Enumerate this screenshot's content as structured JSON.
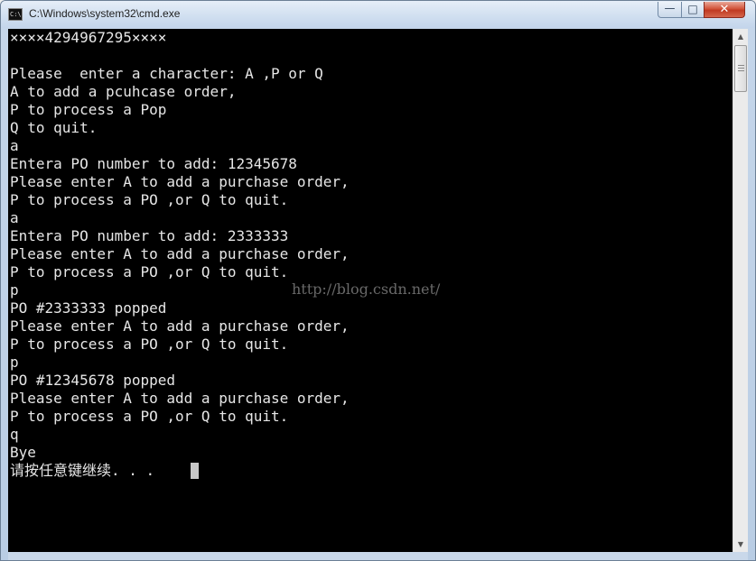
{
  "window": {
    "title": "C:\\Windows\\system32\\cmd.exe",
    "icon_text": "C:\\",
    "controls": {
      "minimize_glyph": "—",
      "maximize_glyph": "□",
      "close_glyph": "✕"
    }
  },
  "console": {
    "lines": [
      "××××4294967295××××",
      "",
      "Please  enter a character: A ,P or Q",
      "A to add a pcuhcase order,",
      "P to process a Pop",
      "Q to quit.",
      "a",
      "Entera PO number to add: 12345678",
      "Please enter A to add a purchase order,",
      "P to process a PO ,or Q to quit.",
      "a",
      "Entera PO number to add: 2333333",
      "Please enter A to add a purchase order,",
      "P to process a PO ,or Q to quit.",
      "p",
      "PO #2333333 popped",
      "Please enter A to add a purchase order,",
      "P to process a PO ,or Q to quit.",
      "p",
      "PO #12345678 popped",
      "Please enter A to add a purchase order,",
      "P to process a PO ,or Q to quit.",
      "q",
      "Bye",
      "请按任意键继续. . ."
    ],
    "watermark": "http://blog.csdn.net/",
    "colors": {
      "background": "#000000",
      "text": "#e6e6e6"
    }
  },
  "scrollbar": {
    "up_arrow": "▲",
    "down_arrow": "▼"
  }
}
